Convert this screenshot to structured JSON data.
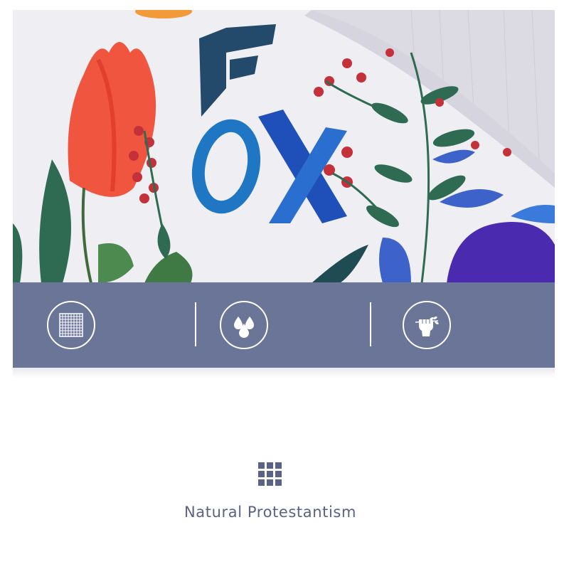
{
  "photo": {
    "print_text": "FOX",
    "colors": {
      "fabric": "#efeef3",
      "wall": "#d9d8e0",
      "tulip": "#f0563f",
      "letter_dark": "#234a6a",
      "letter_blue": "#1f77c4",
      "leaf_green": "#2e6b52",
      "berry_red": "#c5313b",
      "violet": "#4a2bb0"
    }
  },
  "features": {
    "bar_color": "#6b7598",
    "icons": [
      {
        "icon": "mesh-fabric-icon"
      },
      {
        "icon": "water-drops-icon"
      },
      {
        "icon": "fist-holding-plant-icon"
      }
    ]
  },
  "caption": {
    "icon": "grid-icon",
    "text": "Natural Protestantism"
  }
}
